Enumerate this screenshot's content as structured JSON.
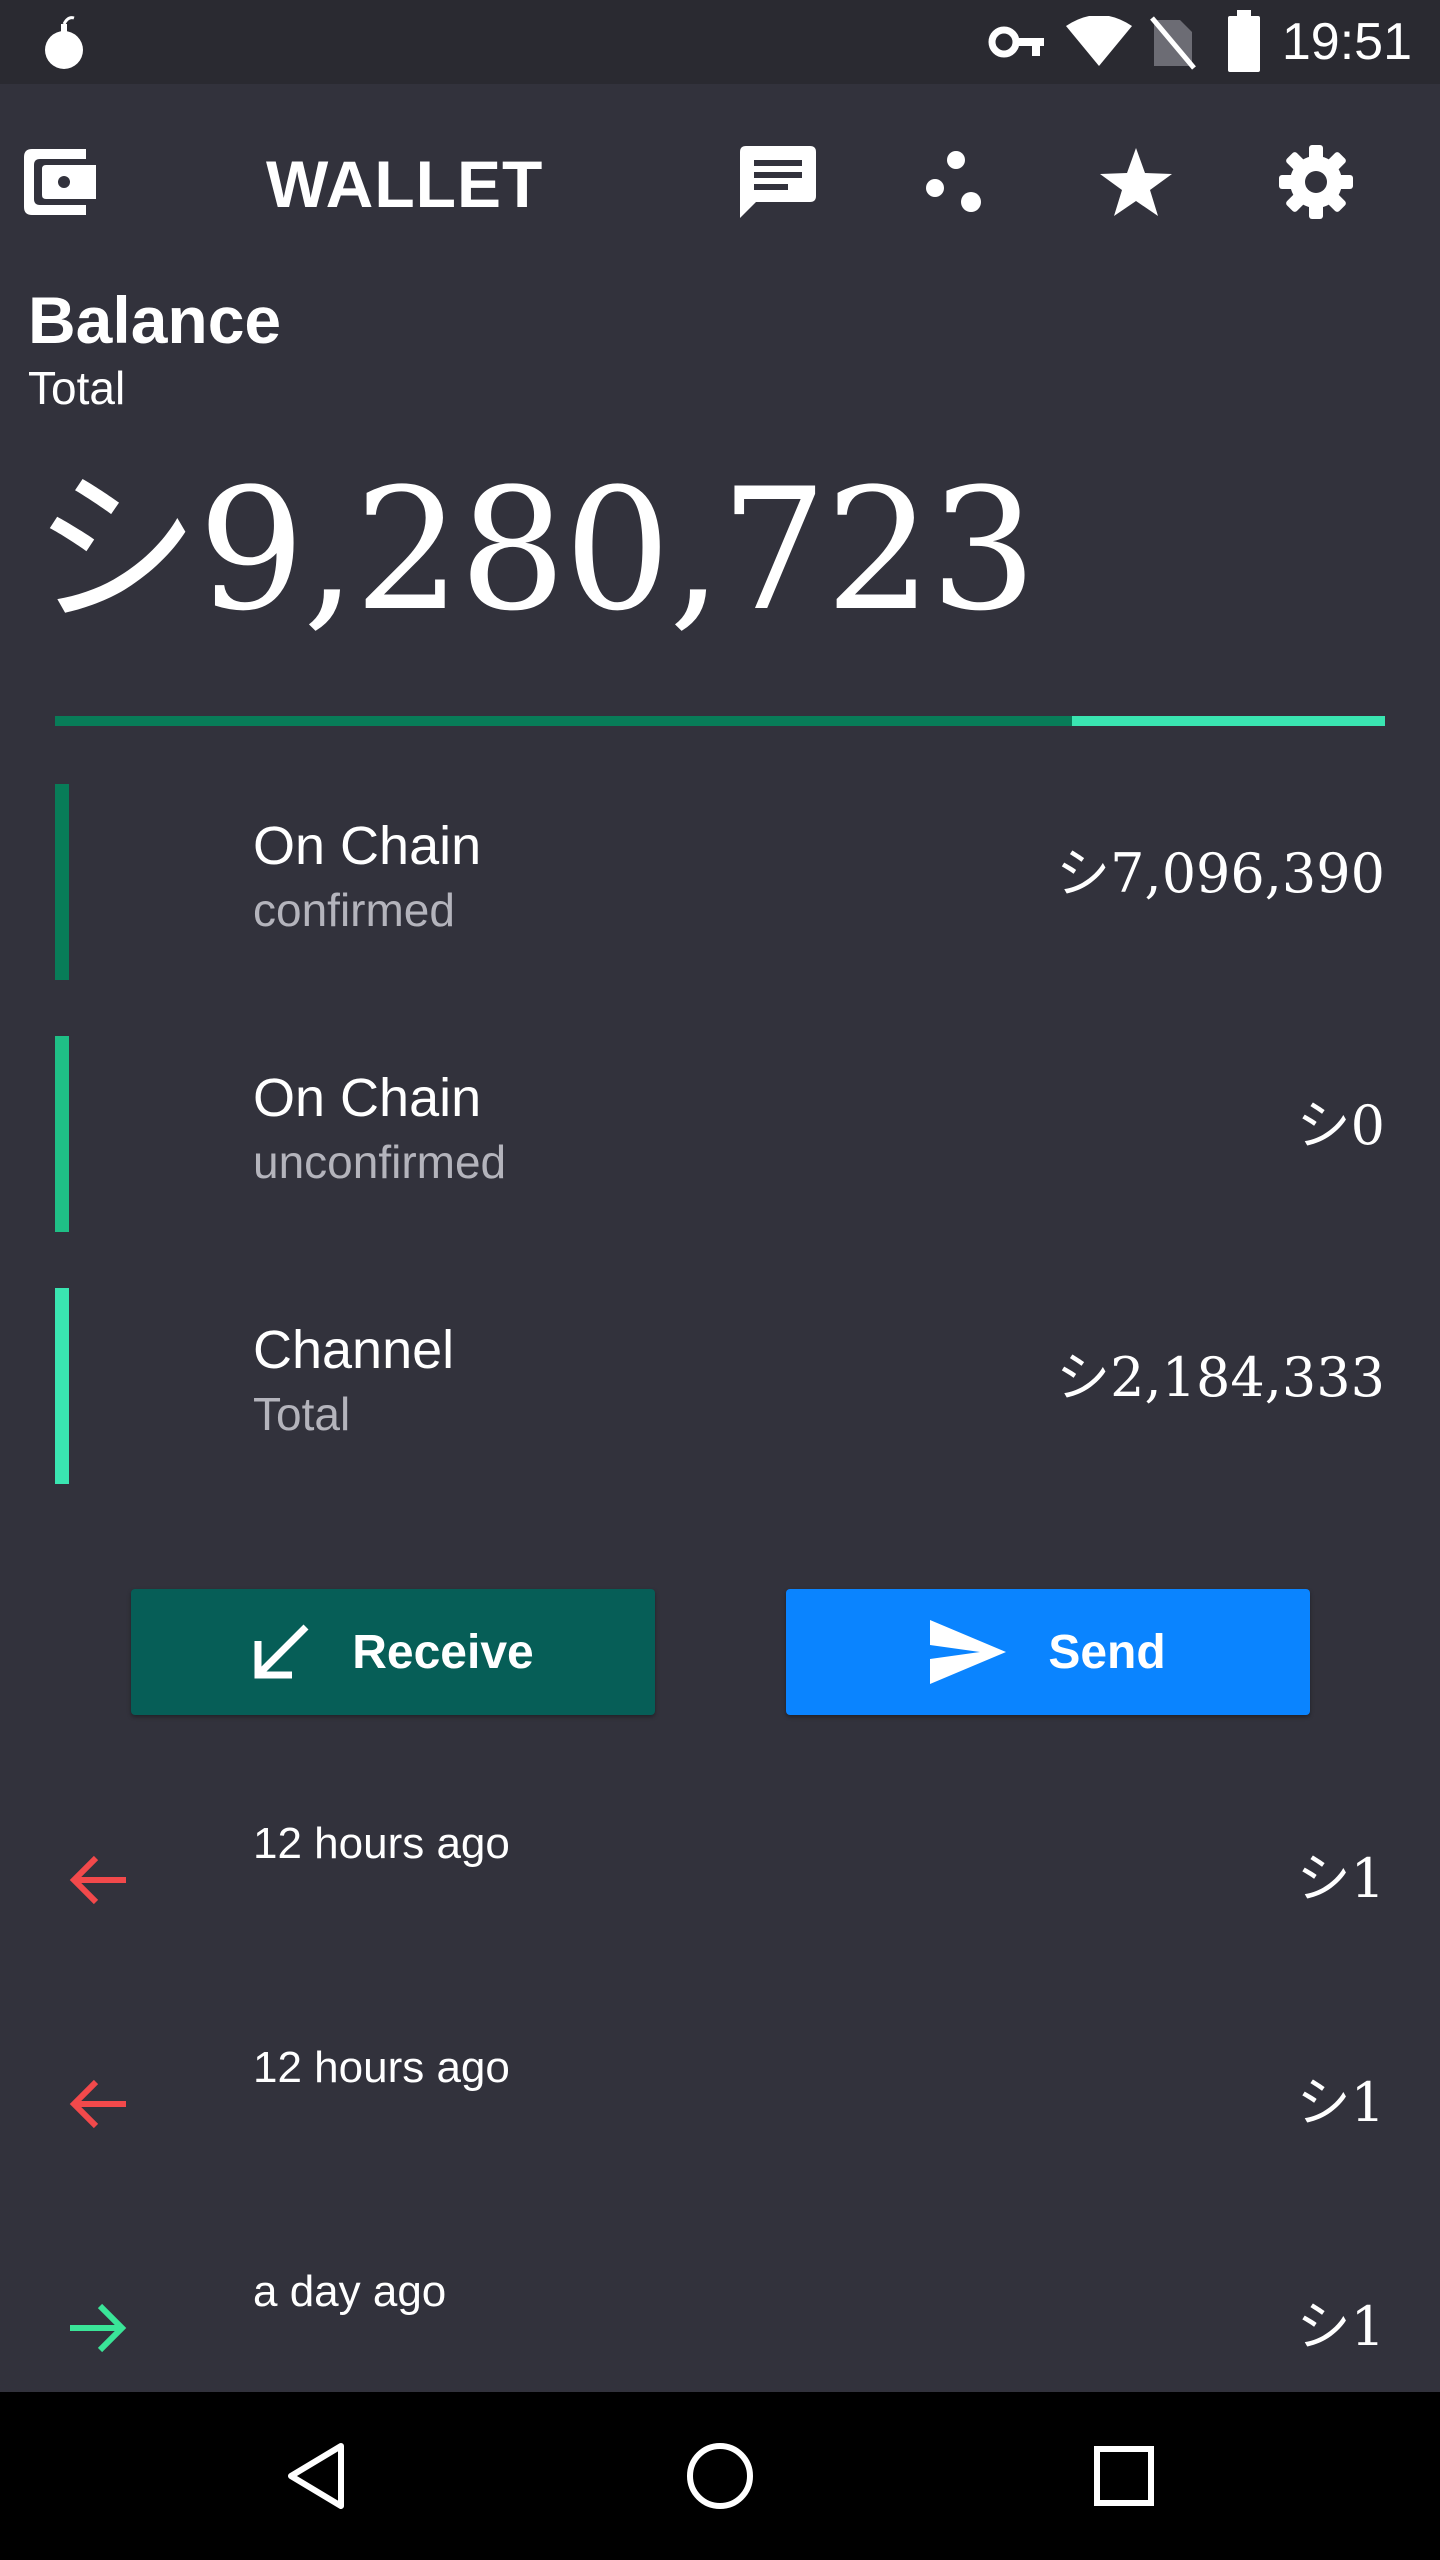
{
  "status_bar": {
    "time": "19:51",
    "icons": [
      "bomb-notification-icon",
      "vpn-key-icon",
      "wifi-icon",
      "no-sim-icon",
      "battery-icon"
    ]
  },
  "app_bar": {
    "title": "WALLET",
    "icons": [
      "wallet-icon",
      "chat-icon",
      "channels-icon",
      "star-icon",
      "settings-icon"
    ]
  },
  "balance": {
    "heading": "Balance",
    "subheading": "Total",
    "amount": "シ9,280,723",
    "on_chain_fraction": 0.765
  },
  "breakdown": [
    {
      "title": "On Chain",
      "subtitle": "confirmed",
      "value": "シ7,096,390",
      "color": "#087c58"
    },
    {
      "title": "On Chain",
      "subtitle": "unconfirmed",
      "value": "シ0",
      "color": "#1fbf86"
    },
    {
      "title": "Channel",
      "subtitle": "Total",
      "value": "シ2,184,333",
      "color": "#3ae5b1"
    }
  ],
  "actions": {
    "receive_label": "Receive",
    "send_label": "Send",
    "receive_color": "#065e57",
    "send_color": "#0a84ff"
  },
  "transactions": [
    {
      "time": "12 hours ago",
      "amount": "シ1",
      "direction": "outgoing",
      "icon": "arrow-left-icon",
      "color": "#f2494b"
    },
    {
      "time": "12 hours ago",
      "amount": "シ1",
      "direction": "outgoing",
      "icon": "arrow-left-icon",
      "color": "#f2494b"
    },
    {
      "time": "a day ago",
      "amount": "シ1",
      "direction": "incoming",
      "icon": "arrow-right-icon",
      "color": "#3ae598"
    }
  ],
  "nav_bar": {
    "icons": [
      "back-icon",
      "home-icon",
      "recents-icon"
    ]
  }
}
